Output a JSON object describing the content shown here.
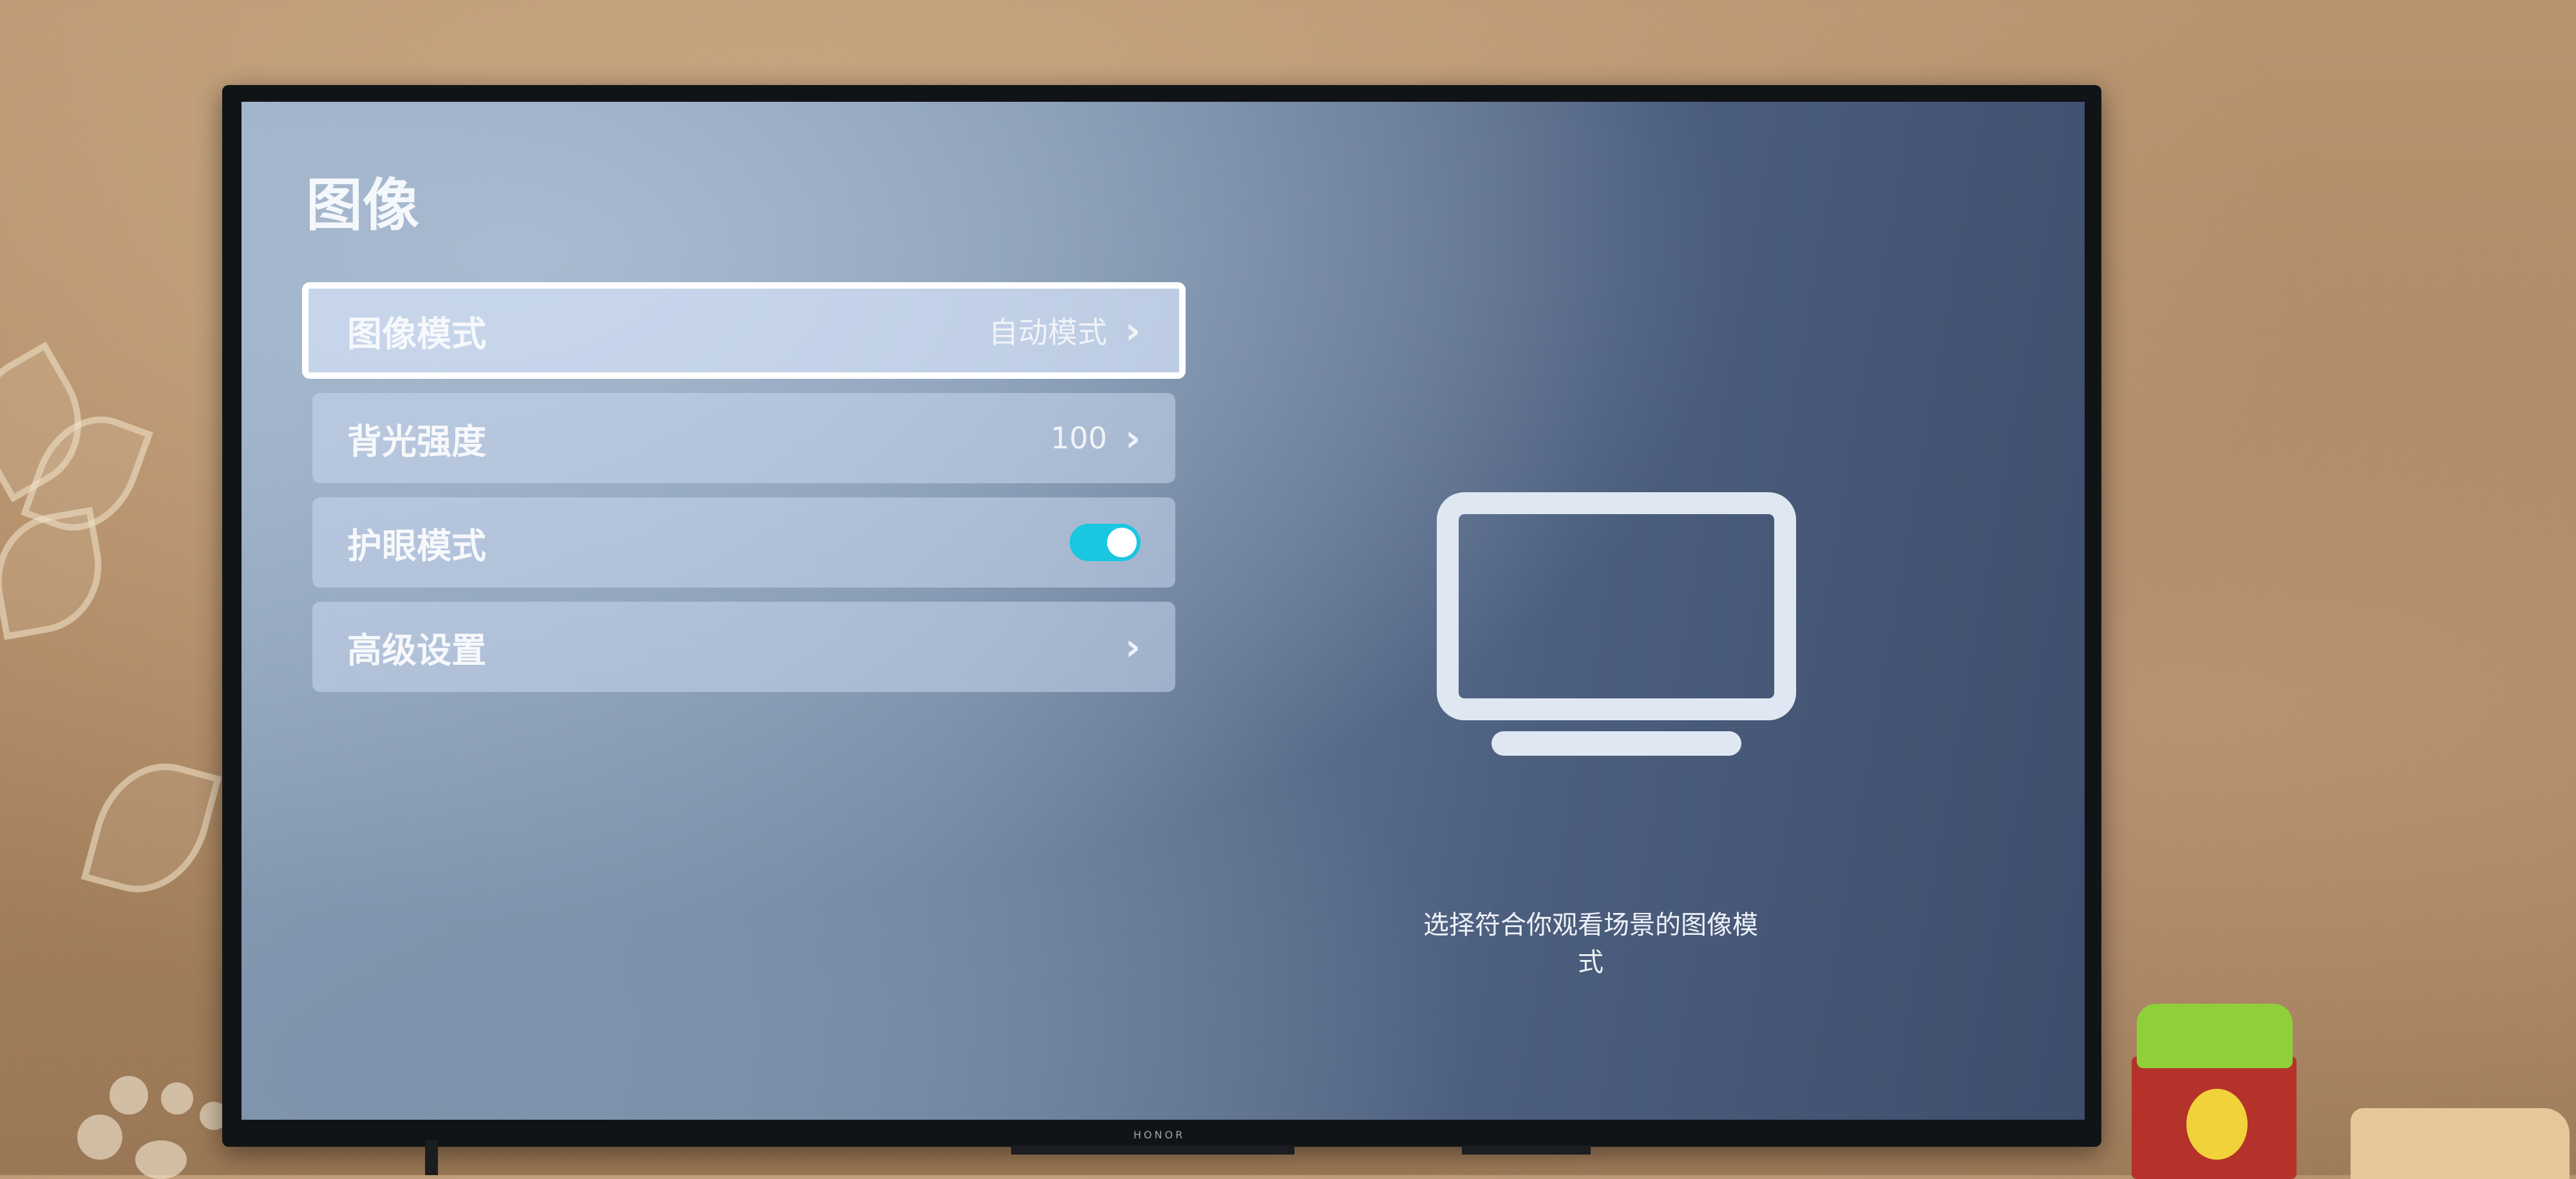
{
  "page": {
    "title": "图像"
  },
  "menu": {
    "items": [
      {
        "label": "图像模式",
        "value": "自动模式",
        "chevron": "›"
      },
      {
        "label": "背光强度",
        "value": "100",
        "chevron": "›"
      },
      {
        "label": "护眼模式",
        "toggle_state": "on"
      },
      {
        "label": "高级设置",
        "chevron": "›"
      }
    ]
  },
  "preview": {
    "icon": "tv-icon",
    "description": "选择符合你观看场景的图像模式"
  },
  "device": {
    "brand": "HONOR"
  },
  "colors": {
    "toggle_on": "#19c7e0",
    "focus_border": "#ffffff"
  }
}
